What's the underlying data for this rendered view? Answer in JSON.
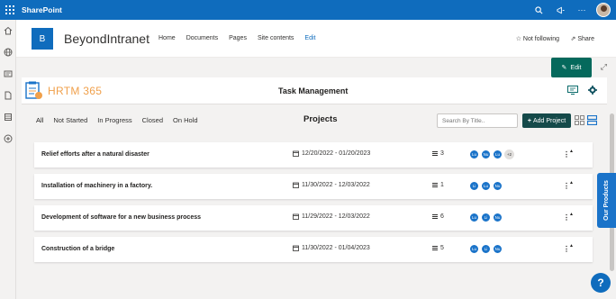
{
  "suite": {
    "title": "SharePoint",
    "icons": [
      "waffle-icon",
      "search-icon",
      "megaphone-icon",
      "more-icon",
      "avatar"
    ],
    "more_label": "···"
  },
  "rail": {
    "icons": [
      "home-icon",
      "globe-icon",
      "news-icon",
      "file-icon",
      "list-icon",
      "add-icon"
    ]
  },
  "site": {
    "logo_letter": "B",
    "name": "BeyondIntranet",
    "nav": [
      "Home",
      "Documents",
      "Pages",
      "Site contents",
      "Edit"
    ],
    "follow_label": "Not following",
    "share_label": "Share"
  },
  "command": {
    "edit_label": "Edit"
  },
  "app": {
    "brand": "HRTM 365",
    "title": "Task Management",
    "filters": [
      "All",
      "Not Started",
      "In Progress",
      "Closed",
      "On Hold"
    ],
    "active_filter": "All",
    "section_title": "Projects",
    "search_placeholder": "Search By Title..",
    "add_label": "Add Project",
    "add_prefix": "+",
    "projects": [
      {
        "name": "Relief efforts after a natural disaster",
        "dates": "12/20/2022 - 01/20/2023",
        "tasks": "3",
        "members": [
          "Lu",
          "Nu",
          "Lu"
        ],
        "extra": "+2"
      },
      {
        "name": "Installation of machinery in a factory.",
        "dates": "11/30/2022 - 12/03/2022",
        "tasks": "1",
        "members": [
          "Li",
          "Lu",
          "Nu"
        ],
        "extra": ""
      },
      {
        "name": "Development of software for a new business process",
        "dates": "11/29/2022 - 12/03/2022",
        "tasks": "6",
        "members": [
          "Lu",
          "Li",
          "Nu"
        ],
        "extra": ""
      },
      {
        "name": "Construction of a bridge",
        "dates": "11/30/2022 - 01/04/2023",
        "tasks": "5",
        "members": [
          "Lu",
          "Li",
          "Nu"
        ],
        "extra": ""
      }
    ]
  },
  "widgets": {
    "our_products": "Our Products",
    "help": "?"
  },
  "colors": {
    "suite_blue": "#0f6cbd",
    "edit_green": "#05695c",
    "add_green": "#154a4a",
    "brand_orange": "#f0a04b",
    "member_blue": "#1a73c9"
  }
}
